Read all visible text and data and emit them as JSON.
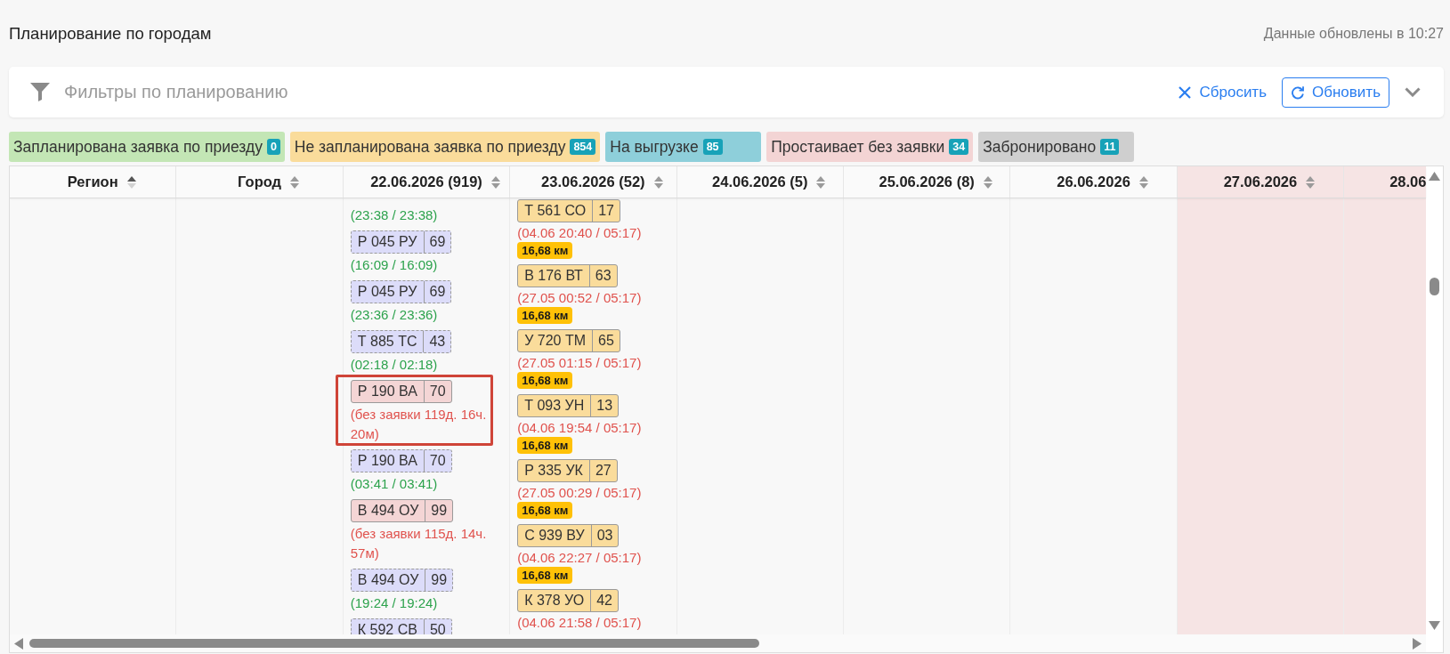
{
  "page": {
    "title": "Планирование по городам",
    "updated": "Данные обновлены в 10:27"
  },
  "filters": {
    "title": "Фильтры по планированию",
    "reset": "Сбросить",
    "refresh": "Обновить",
    "expanded": false
  },
  "legend": [
    {
      "label": "Запланирована заявка по приезду",
      "count": "0",
      "color": "#c3e6b5"
    },
    {
      "label": "Не запланирована заявка по приезду",
      "count": "854",
      "color": "#fadc9b"
    },
    {
      "label": "На выгрузке",
      "count": "85",
      "color": "#8ecfda"
    },
    {
      "label": "Простаивает без заявки",
      "count": "34",
      "color": "#f3d4d4"
    },
    {
      "label": "Забронировано",
      "count": "11",
      "color": "#cfcfcf"
    }
  ],
  "table": {
    "columns": [
      {
        "label": "Регион",
        "sorted": true,
        "highlighted": false
      },
      {
        "label": "Город",
        "sorted": false,
        "highlighted": false
      },
      {
        "label": "22.06.2026 (919)",
        "sorted": false,
        "highlighted": false,
        "items": [
          {
            "kind": "planned",
            "time": "(23:38 / 23:38)",
            "marked": false
          },
          {
            "kind": "planned",
            "plate": "Р 045 РУ",
            "region": "69",
            "time": "(16:09 / 16:09)",
            "marked": false
          },
          {
            "kind": "planned",
            "plate": "Р 045 РУ",
            "region": "69",
            "time": "(23:36 / 23:36)",
            "marked": false
          },
          {
            "kind": "planned",
            "plate": "Т 885 ТС",
            "region": "43",
            "time": "(02:18 / 02:18)",
            "marked": false
          },
          {
            "kind": "idle",
            "plate": "Р 190 ВА",
            "region": "70",
            "time": "(без заявки 119д. 16ч. 20м)",
            "marked": true
          },
          {
            "kind": "planned",
            "plate": "Р 190 ВА",
            "region": "70",
            "time": "(03:41 / 03:41)",
            "marked": false
          },
          {
            "kind": "idle",
            "plate": "В 494 ОУ",
            "region": "99",
            "time": "(без заявки 115д. 14ч. 57м)",
            "marked": false
          },
          {
            "kind": "planned",
            "plate": "В 494 ОУ",
            "region": "99",
            "time": "(19:24 / 19:24)",
            "marked": false
          },
          {
            "kind": "planned",
            "plate": "К 592 СВ",
            "region": "50",
            "marked": false
          }
        ]
      },
      {
        "label": "23.06.2026 (52)",
        "sorted": false,
        "highlighted": false,
        "items": [
          {
            "kind": "unplanned",
            "plate": "Т 561 СО",
            "region": "17",
            "time": "(04.06 20:40 / 05:17)",
            "distance": "16,68 км",
            "marked": false
          },
          {
            "kind": "unplanned",
            "plate": "В 176 ВТ",
            "region": "63",
            "time": "(27.05 00:52 / 05:17)",
            "distance": "16,68 км",
            "marked": false
          },
          {
            "kind": "unplanned",
            "plate": "У 720 ТМ",
            "region": "65",
            "time": "(27.05 01:15 / 05:17)",
            "distance": "16,68 км",
            "marked": false
          },
          {
            "kind": "unplanned",
            "plate": "Т 093 УН",
            "region": "13",
            "time": "(04.06 19:54 / 05:17)",
            "distance": "16,68 км",
            "marked": false
          },
          {
            "kind": "unplanned",
            "plate": "Р 335 УК",
            "region": "27",
            "time": "(27.05 00:29 / 05:17)",
            "distance": "16,68 км",
            "marked": false
          },
          {
            "kind": "unplanned",
            "plate": "С 939 ВУ",
            "region": "03",
            "time": "(04.06 22:27 / 05:17)",
            "distance": "16,68 км",
            "marked": false
          },
          {
            "kind": "unplanned",
            "plate": "К 378 УО",
            "region": "42",
            "time": "(04.06 21:58 / 05:17)",
            "marked": false
          }
        ]
      },
      {
        "label": "24.06.2026 (5)",
        "sorted": false,
        "highlighted": false
      },
      {
        "label": "25.06.2026 (8)",
        "sorted": false,
        "highlighted": false
      },
      {
        "label": "26.06.2026",
        "sorted": false,
        "highlighted": false
      },
      {
        "label": "27.06.2026",
        "sorted": false,
        "highlighted": true
      },
      {
        "label": "28.06",
        "highlighted": true
      }
    ]
  }
}
